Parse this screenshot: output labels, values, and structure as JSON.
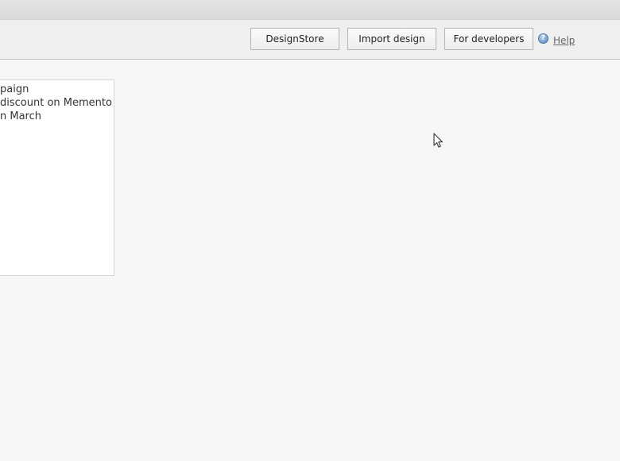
{
  "toolbar": {
    "buttons": [
      {
        "label": "DesignStore"
      },
      {
        "label": "Import design"
      },
      {
        "label": "For developers"
      }
    ],
    "help_label": "Help",
    "help_icon": "question-icon"
  },
  "card": {
    "lines": [
      "paign",
      "discount on Memento",
      "n March"
    ]
  },
  "cursor": {
    "icon": "mouse-pointer-icon"
  }
}
